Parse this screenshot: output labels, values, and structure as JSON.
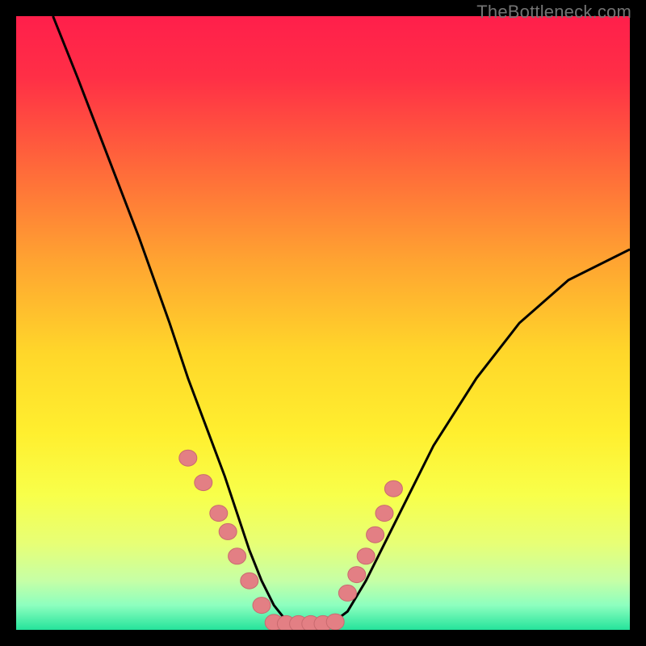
{
  "watermark": "TheBottleneck.com",
  "colors": {
    "frame_bg": "#000000",
    "gradient_stops": [
      {
        "offset": 0.0,
        "color": "#ff1f4b"
      },
      {
        "offset": 0.1,
        "color": "#ff2f46"
      },
      {
        "offset": 0.25,
        "color": "#ff6a3a"
      },
      {
        "offset": 0.4,
        "color": "#ffa431"
      },
      {
        "offset": 0.55,
        "color": "#ffd72a"
      },
      {
        "offset": 0.68,
        "color": "#ffef2f"
      },
      {
        "offset": 0.78,
        "color": "#f8ff4a"
      },
      {
        "offset": 0.86,
        "color": "#e7ff76"
      },
      {
        "offset": 0.92,
        "color": "#c6ffa6"
      },
      {
        "offset": 0.96,
        "color": "#8dffbf"
      },
      {
        "offset": 1.0,
        "color": "#25e39b"
      }
    ],
    "curve": "#000000",
    "dot_fill": "#e37f84",
    "dot_stroke": "#c96a6f"
  },
  "chart_data": {
    "type": "line",
    "title": "",
    "xlabel": "",
    "ylabel": "",
    "xlim": [
      0,
      100
    ],
    "ylim": [
      0,
      100
    ],
    "note": "Axes are implicit (no tick labels in image). Curve values are estimated percentages of plot height where 0 = bottom (green) and 100 = top (red).",
    "series": [
      {
        "name": "bottleneck-curve",
        "x": [
          6,
          10,
          15,
          20,
          25,
          28,
          31,
          34,
          36,
          38,
          40,
          42,
          44,
          46,
          48,
          50,
          52,
          54,
          57,
          62,
          68,
          75,
          82,
          90,
          100
        ],
        "y": [
          100,
          90,
          77,
          64,
          50,
          41,
          33,
          25,
          19,
          13,
          8,
          4,
          1.5,
          1,
          1,
          1,
          1.5,
          3,
          8,
          18,
          30,
          41,
          50,
          57,
          62
        ]
      }
    ],
    "markers": [
      {
        "name": "left-cluster",
        "x": [
          28,
          30.5,
          33,
          34.5,
          36,
          38,
          40
        ],
        "y": [
          28,
          24,
          19,
          16,
          12,
          8,
          4
        ]
      },
      {
        "name": "valley-floor",
        "x": [
          42,
          44,
          46,
          48,
          50,
          52
        ],
        "y": [
          1.2,
          1,
          1,
          1,
          1,
          1.3
        ]
      },
      {
        "name": "right-cluster",
        "x": [
          54,
          55.5,
          57,
          58.5,
          60,
          61.5
        ],
        "y": [
          6,
          9,
          12,
          15.5,
          19,
          23
        ]
      }
    ]
  }
}
